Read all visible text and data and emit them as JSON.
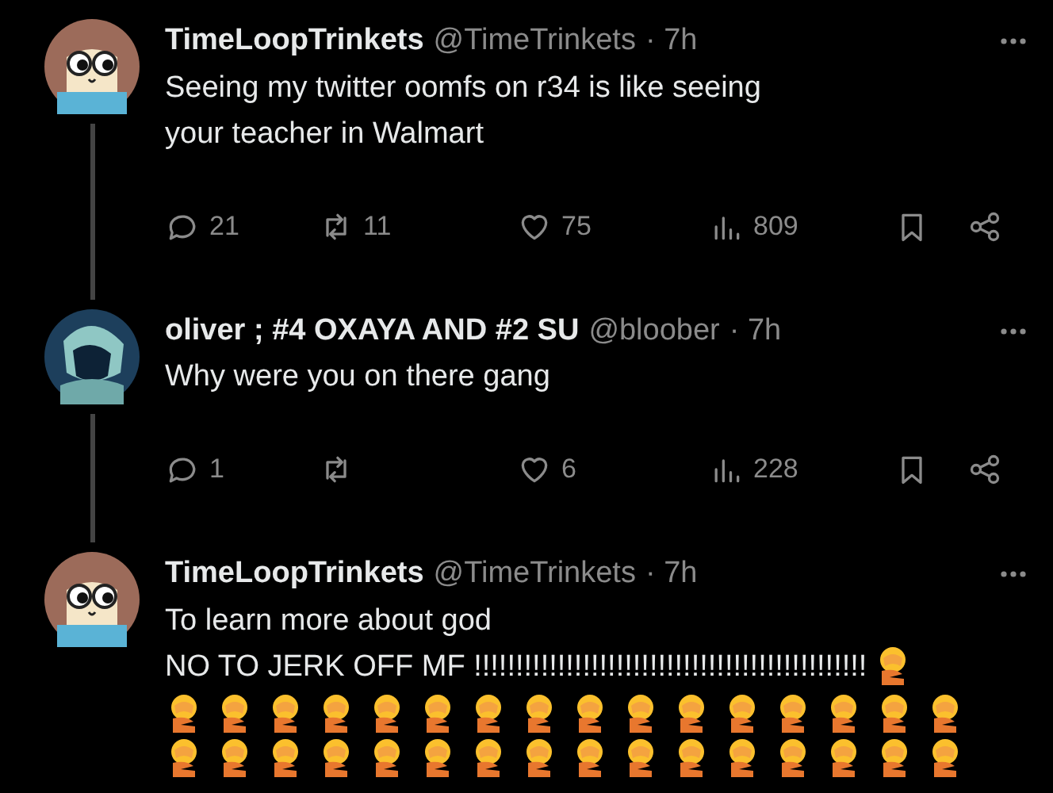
{
  "tweets": [
    {
      "display_name": "TimeLoopTrinkets",
      "handle": "@TimeTrinkets",
      "time": "· 7h",
      "avatar": {
        "kind": "cartoon"
      },
      "lines": [
        "Seeing my twitter oomfs on r34 is like seeing",
        "your teacher in Walmart"
      ],
      "actions": {
        "replies": "21",
        "reposts": "11",
        "likes": "75",
        "views": "809"
      },
      "thread_line": true
    },
    {
      "display_name": "oliver ; #4 OXAYA AND #2 SU",
      "handle": "@bloober",
      "time": "· 7h",
      "avatar": {
        "kind": "dark"
      },
      "lines": [
        "Why were you on there gang"
      ],
      "actions": {
        "replies": "1",
        "likes": "6",
        "views": "228"
      },
      "thread_line": true
    },
    {
      "display_name": "TimeLoopTrinkets",
      "handle": "@TimeTrinkets",
      "time": "· 7h",
      "avatar": {
        "kind": "cartoon"
      },
      "lines": [
        "To learn more about god",
        "NO TO JERK OFF MF !!!!!!!!!!!!!!!!!!!!!!!!!!!!!!!!!!!!!!!!!!!!!!!"
      ],
      "emoji_rows": [
        [
          {
            "kind": "facepalm"
          }
        ],
        [
          {
            "kind": "facepalm"
          },
          {
            "kind": "facepalm"
          },
          {
            "kind": "facepalm"
          },
          {
            "kind": "facepalm"
          },
          {
            "kind": "facepalm"
          },
          {
            "kind": "facepalm"
          },
          {
            "kind": "facepalm"
          },
          {
            "kind": "facepalm"
          },
          {
            "kind": "facepalm"
          },
          {
            "kind": "facepalm"
          },
          {
            "kind": "facepalm"
          },
          {
            "kind": "facepalm"
          },
          {
            "kind": "facepalm"
          },
          {
            "kind": "facepalm"
          },
          {
            "kind": "facepalm"
          },
          {
            "kind": "facepalm"
          }
        ],
        [
          {
            "kind": "facepalm"
          },
          {
            "kind": "facepalm"
          },
          {
            "kind": "facepalm"
          },
          {
            "kind": "facepalm"
          },
          {
            "kind": "facepalm"
          },
          {
            "kind": "facepalm"
          },
          {
            "kind": "facepalm"
          },
          {
            "kind": "facepalm"
          },
          {
            "kind": "facepalm"
          },
          {
            "kind": "facepalm"
          },
          {
            "kind": "facepalm"
          },
          {
            "kind": "facepalm"
          },
          {
            "kind": "facepalm"
          },
          {
            "kind": "facepalm"
          },
          {
            "kind": "facepalm"
          },
          {
            "kind": "facepalm"
          }
        ]
      ],
      "thread_line": false
    }
  ]
}
